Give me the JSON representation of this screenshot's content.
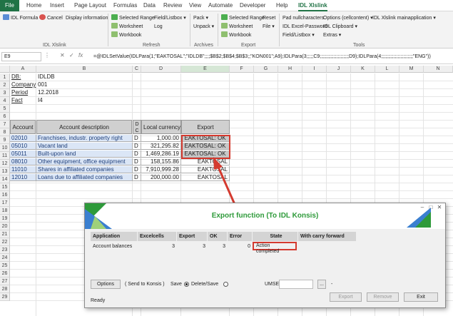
{
  "ribbon_tabs": [
    "File",
    "Home",
    "Insert",
    "Page Layout",
    "Formulas",
    "Data",
    "Review",
    "View",
    "Automate",
    "Developer",
    "Help",
    "IDL Xlslink"
  ],
  "ribbon": {
    "idl_formula": "IDL Formula",
    "cancel": "Cancel",
    "display_information": "Display information",
    "group_idl": "IDL Xlslink",
    "selected_range": "Selected Range",
    "field_listbox": "Field/Listbox",
    "worksheet": "Worksheet",
    "log": "Log",
    "workbook": "Workbook",
    "group_refresh": "Refresh",
    "pack": "Pack",
    "unpack": "Unpack",
    "group_archives": "Archives",
    "exp_selected_range": "Selected Range",
    "reset": "Reset",
    "exp_worksheet": "Worksheet",
    "file": "File",
    "exp_workbook": "Workbook",
    "group_export": "Export",
    "pad_nullcharacters": "Pad nullcharacters",
    "options_cellcontent": "Options (cellcontent)",
    "idl_mainapp": "IDL Xlslink mainapplication",
    "idl_excel_password": "IDL Excel-Password",
    "idl_clipboard": "IDL Clipboard",
    "tools_field_listbox": "Field/Listbox",
    "extras": "Extras",
    "group_tools": "Tools"
  },
  "formula_bar": {
    "name_box": "E9",
    "formula": "=@IDLSetValue(IDLPara(1;\"EAKTOSAL\";\"IDLDB\";;;;$B$2;$B$4;$B$3;;\"KON001\";A9);IDLPara(3;;;;;C9;;;;;;;;;;;;;;;;;;;;;D9);IDLPara(4;;;;;;;;;;;;;;;;;;;;;;;\"ENG\"))"
  },
  "columns": [
    "A",
    "B",
    "C",
    "D",
    "E",
    "F",
    "G",
    "H",
    "I",
    "J",
    "K",
    "L",
    "M",
    "N"
  ],
  "info_rows": [
    {
      "label": "DB:",
      "value": "IDLDB"
    },
    {
      "label": "Company",
      "value": "001"
    },
    {
      "label": "Period",
      "value": "12.2018"
    },
    {
      "label": "Fact",
      "value": "I4"
    }
  ],
  "table_headers": {
    "account": "Account",
    "description": "Account description",
    "dc": "D C",
    "currency": "Local currency",
    "export": "Export"
  },
  "table_rows": [
    {
      "account": "02010",
      "description": "Franchises, industr. property right",
      "dc": "D",
      "amount": "1,000.00",
      "export": "EAKTOSAL: OK"
    },
    {
      "account": "05010",
      "description": "Vacant land",
      "dc": "D",
      "amount": "321,295.82",
      "export": "EAKTOSAL: OK"
    },
    {
      "account": "05011",
      "description": "Built-upon land",
      "dc": "D",
      "amount": "1,469,286.19",
      "export": "EAKTOSAL: OK"
    },
    {
      "account": "08010",
      "description": "Other equipment, office equipment",
      "dc": "D",
      "amount": "158,155.86",
      "export": "EAKTOSAL"
    },
    {
      "account": "11010",
      "description": "Shares in affiliated companies",
      "dc": "D",
      "amount": "7,910,999.28",
      "export": "EAKTOSAL"
    },
    {
      "account": "12010",
      "description": "Loans due to affiliated companies",
      "dc": "D",
      "amount": "200,000.00",
      "export": "EAKTOSAL"
    }
  ],
  "row_numbers": [
    "1",
    "2",
    "3",
    "4",
    "5",
    "6",
    "7",
    "8",
    "9",
    "10",
    "11",
    "12",
    "13",
    "14",
    "15",
    "16",
    "17",
    "18",
    "19",
    "20",
    "21",
    "22",
    "23",
    "24",
    "25",
    "26",
    "27",
    "28",
    "29"
  ],
  "dialog": {
    "title": "Export function  (To IDL Konsis)",
    "headers": [
      "Application",
      "Excelcells",
      "Export",
      "OK",
      "Error",
      "State",
      "With carry forward"
    ],
    "row": {
      "application": "Account balances",
      "excelcells": "3",
      "export": "3",
      "ok": "3",
      "error": "0",
      "state": "Action completed",
      "carry": ""
    },
    "options_button": "Options",
    "send_to_konsis": "( Send to Konsis )",
    "save_label": "Save",
    "delete_save_label": "Delete/Save",
    "umse_label": "UMSE",
    "umse_value": "",
    "browse_button": "...",
    "dash": "-",
    "export_button": "Export",
    "remove_button": "Remove",
    "exit_button": "Exit",
    "status": "Ready"
  },
  "colors": {
    "excel_green": "#217346",
    "title_green": "#2e9a3a",
    "highlight_red": "#d43a2f",
    "row_blue": "#dbe6f6"
  }
}
